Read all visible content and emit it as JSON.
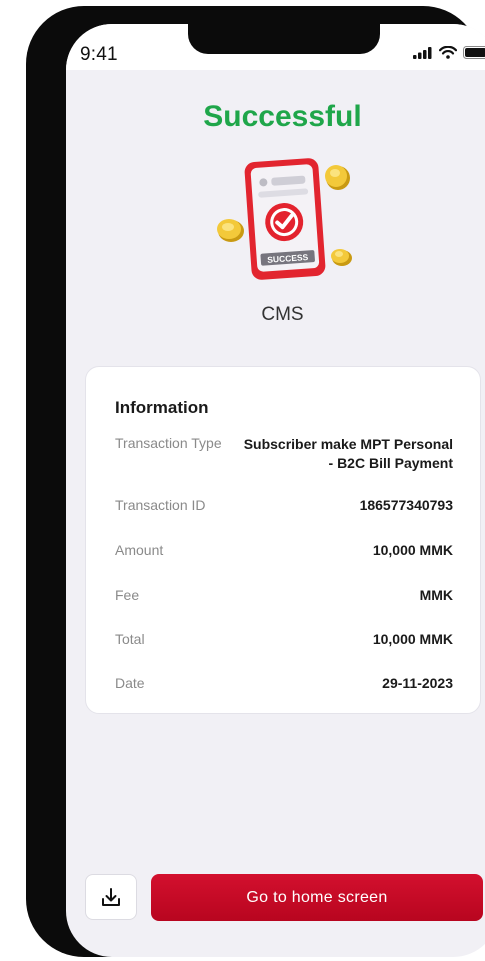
{
  "status_bar": {
    "time": "9:41",
    "icons": [
      "signal-icon",
      "wifi-icon",
      "battery-icon"
    ]
  },
  "header": {
    "title": "Successful",
    "title_color": "#1fa64a"
  },
  "hero": {
    "illustration": "success-phone-illustration",
    "badge_text": "SUCCESS"
  },
  "merchant": {
    "name": "CMS"
  },
  "info_card": {
    "title": "Information",
    "transaction_type_label": "Transaction Type",
    "transaction_type_value_line1": "Subscriber make MPT Personal",
    "transaction_type_value_line2": "- B2C Bill Payment",
    "transaction_id_label": "Transaction ID",
    "transaction_id_value": "186577340793",
    "amount_label": "Amount",
    "amount_value": "10,000 MMK",
    "fee_label": "Fee",
    "fee_value": "MMK",
    "total_label": "Total",
    "total_value": "10,000 MMK",
    "date_label": "Date",
    "date_value": "29-11-2023"
  },
  "actions": {
    "download_icon": "download-icon",
    "home_label": "Go to home screen",
    "accent": "#c90a26"
  }
}
